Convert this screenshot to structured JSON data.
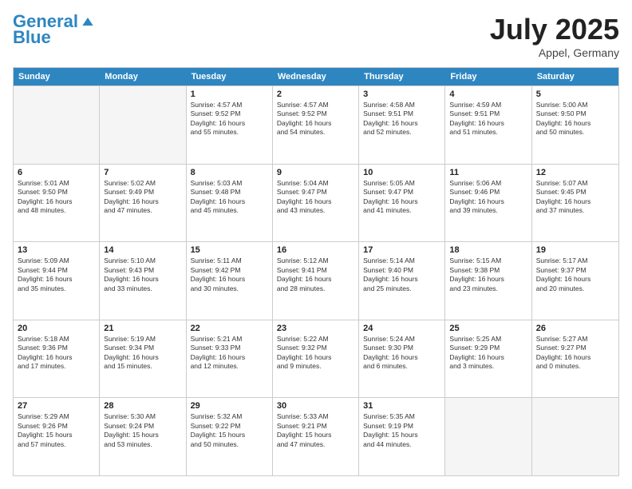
{
  "logo": {
    "line1": "General",
    "line2": "Blue"
  },
  "title": "July 2025",
  "location": "Appel, Germany",
  "days_header": [
    "Sunday",
    "Monday",
    "Tuesday",
    "Wednesday",
    "Thursday",
    "Friday",
    "Saturday"
  ],
  "rows": [
    [
      {
        "num": "",
        "text": "",
        "empty": true
      },
      {
        "num": "",
        "text": "",
        "empty": true
      },
      {
        "num": "1",
        "text": "Sunrise: 4:57 AM\nSunset: 9:52 PM\nDaylight: 16 hours\nand 55 minutes."
      },
      {
        "num": "2",
        "text": "Sunrise: 4:57 AM\nSunset: 9:52 PM\nDaylight: 16 hours\nand 54 minutes."
      },
      {
        "num": "3",
        "text": "Sunrise: 4:58 AM\nSunset: 9:51 PM\nDaylight: 16 hours\nand 52 minutes."
      },
      {
        "num": "4",
        "text": "Sunrise: 4:59 AM\nSunset: 9:51 PM\nDaylight: 16 hours\nand 51 minutes."
      },
      {
        "num": "5",
        "text": "Sunrise: 5:00 AM\nSunset: 9:50 PM\nDaylight: 16 hours\nand 50 minutes."
      }
    ],
    [
      {
        "num": "6",
        "text": "Sunrise: 5:01 AM\nSunset: 9:50 PM\nDaylight: 16 hours\nand 48 minutes."
      },
      {
        "num": "7",
        "text": "Sunrise: 5:02 AM\nSunset: 9:49 PM\nDaylight: 16 hours\nand 47 minutes."
      },
      {
        "num": "8",
        "text": "Sunrise: 5:03 AM\nSunset: 9:48 PM\nDaylight: 16 hours\nand 45 minutes."
      },
      {
        "num": "9",
        "text": "Sunrise: 5:04 AM\nSunset: 9:47 PM\nDaylight: 16 hours\nand 43 minutes."
      },
      {
        "num": "10",
        "text": "Sunrise: 5:05 AM\nSunset: 9:47 PM\nDaylight: 16 hours\nand 41 minutes."
      },
      {
        "num": "11",
        "text": "Sunrise: 5:06 AM\nSunset: 9:46 PM\nDaylight: 16 hours\nand 39 minutes."
      },
      {
        "num": "12",
        "text": "Sunrise: 5:07 AM\nSunset: 9:45 PM\nDaylight: 16 hours\nand 37 minutes."
      }
    ],
    [
      {
        "num": "13",
        "text": "Sunrise: 5:09 AM\nSunset: 9:44 PM\nDaylight: 16 hours\nand 35 minutes."
      },
      {
        "num": "14",
        "text": "Sunrise: 5:10 AM\nSunset: 9:43 PM\nDaylight: 16 hours\nand 33 minutes."
      },
      {
        "num": "15",
        "text": "Sunrise: 5:11 AM\nSunset: 9:42 PM\nDaylight: 16 hours\nand 30 minutes."
      },
      {
        "num": "16",
        "text": "Sunrise: 5:12 AM\nSunset: 9:41 PM\nDaylight: 16 hours\nand 28 minutes."
      },
      {
        "num": "17",
        "text": "Sunrise: 5:14 AM\nSunset: 9:40 PM\nDaylight: 16 hours\nand 25 minutes."
      },
      {
        "num": "18",
        "text": "Sunrise: 5:15 AM\nSunset: 9:38 PM\nDaylight: 16 hours\nand 23 minutes."
      },
      {
        "num": "19",
        "text": "Sunrise: 5:17 AM\nSunset: 9:37 PM\nDaylight: 16 hours\nand 20 minutes."
      }
    ],
    [
      {
        "num": "20",
        "text": "Sunrise: 5:18 AM\nSunset: 9:36 PM\nDaylight: 16 hours\nand 17 minutes."
      },
      {
        "num": "21",
        "text": "Sunrise: 5:19 AM\nSunset: 9:34 PM\nDaylight: 16 hours\nand 15 minutes."
      },
      {
        "num": "22",
        "text": "Sunrise: 5:21 AM\nSunset: 9:33 PM\nDaylight: 16 hours\nand 12 minutes."
      },
      {
        "num": "23",
        "text": "Sunrise: 5:22 AM\nSunset: 9:32 PM\nDaylight: 16 hours\nand 9 minutes."
      },
      {
        "num": "24",
        "text": "Sunrise: 5:24 AM\nSunset: 9:30 PM\nDaylight: 16 hours\nand 6 minutes."
      },
      {
        "num": "25",
        "text": "Sunrise: 5:25 AM\nSunset: 9:29 PM\nDaylight: 16 hours\nand 3 minutes."
      },
      {
        "num": "26",
        "text": "Sunrise: 5:27 AM\nSunset: 9:27 PM\nDaylight: 16 hours\nand 0 minutes."
      }
    ],
    [
      {
        "num": "27",
        "text": "Sunrise: 5:29 AM\nSunset: 9:26 PM\nDaylight: 15 hours\nand 57 minutes."
      },
      {
        "num": "28",
        "text": "Sunrise: 5:30 AM\nSunset: 9:24 PM\nDaylight: 15 hours\nand 53 minutes."
      },
      {
        "num": "29",
        "text": "Sunrise: 5:32 AM\nSunset: 9:22 PM\nDaylight: 15 hours\nand 50 minutes."
      },
      {
        "num": "30",
        "text": "Sunrise: 5:33 AM\nSunset: 9:21 PM\nDaylight: 15 hours\nand 47 minutes."
      },
      {
        "num": "31",
        "text": "Sunrise: 5:35 AM\nSunset: 9:19 PM\nDaylight: 15 hours\nand 44 minutes."
      },
      {
        "num": "",
        "text": "",
        "empty": true
      },
      {
        "num": "",
        "text": "",
        "empty": true
      }
    ]
  ]
}
